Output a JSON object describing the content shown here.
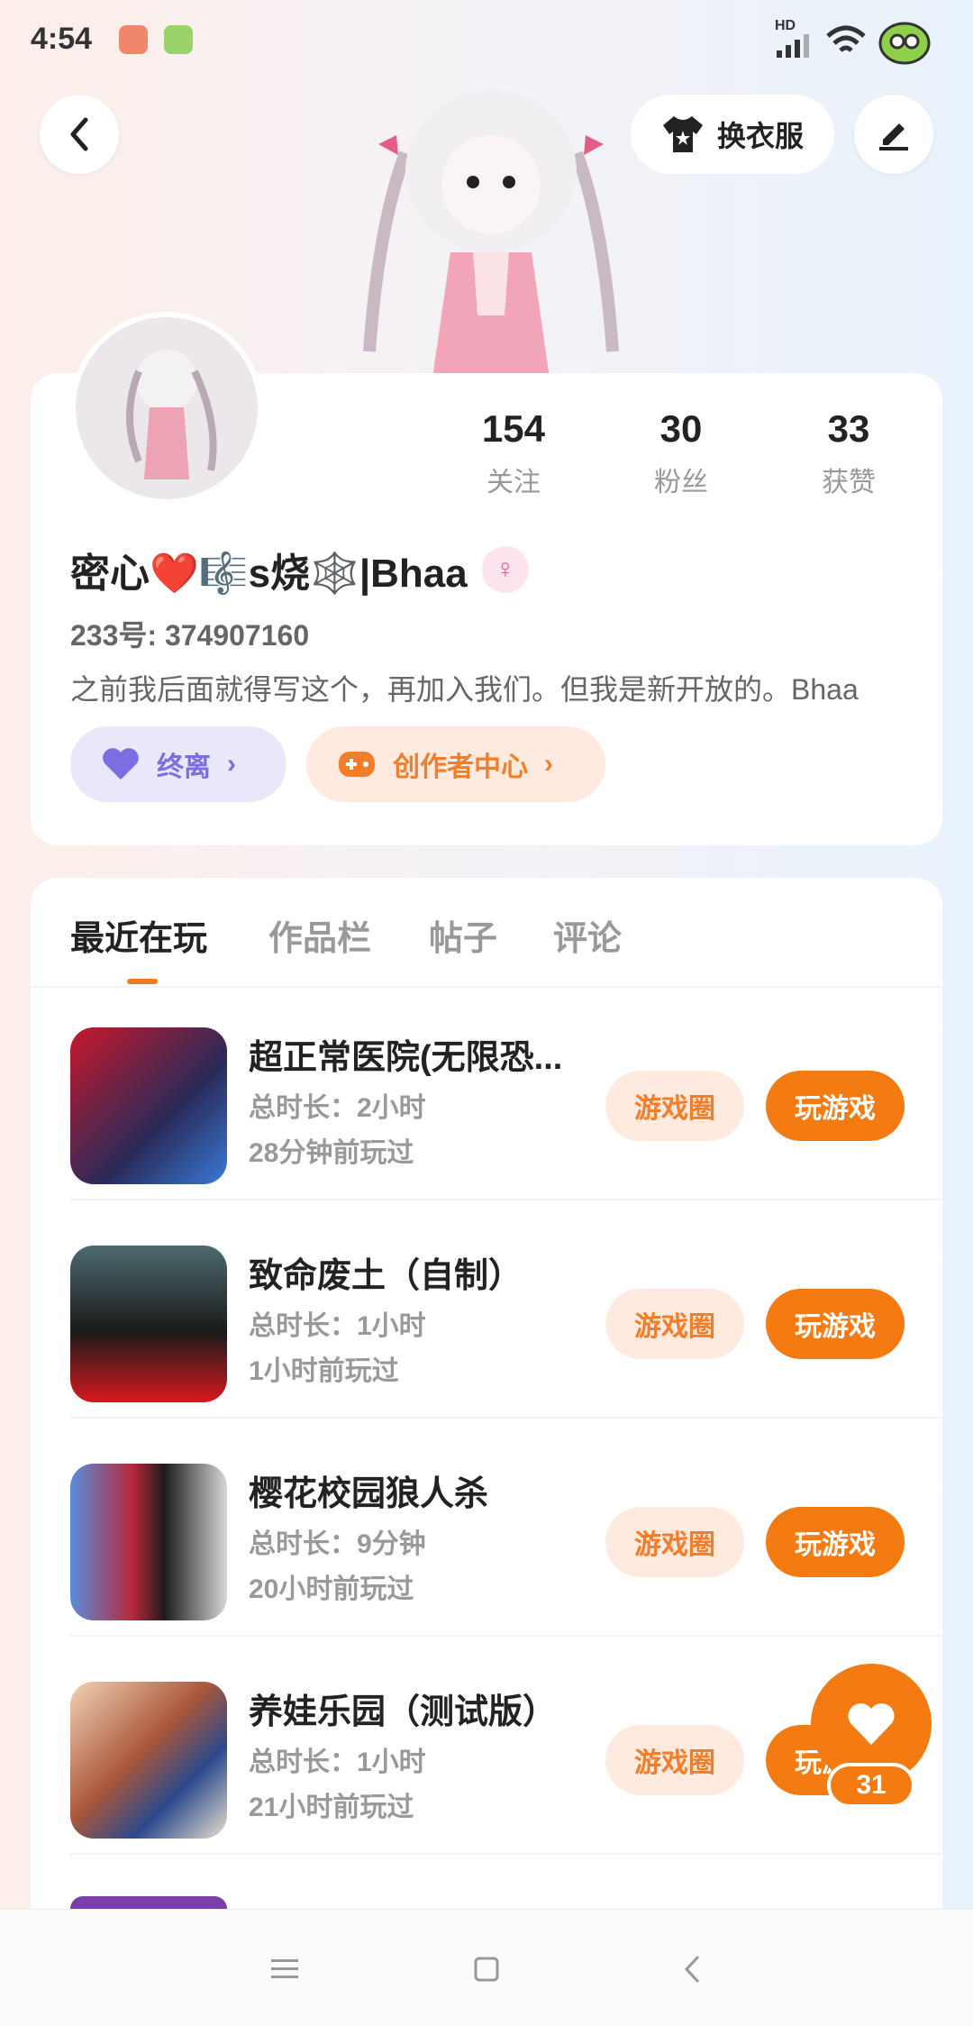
{
  "status": {
    "time": "4:54",
    "network": "HD"
  },
  "header": {
    "outfit_label": "换衣服"
  },
  "profile": {
    "stats": [
      {
        "num": "154",
        "label": "关注"
      },
      {
        "num": "30",
        "label": "粉丝"
      },
      {
        "num": "33",
        "label": "获赞"
      }
    ],
    "username": "密心❤️🎼s烧🕸️|Bhaa",
    "uid": "233号: 374907160",
    "bio": "之前我后面就得写这个，再加入我们。但我是新开放的。Bhaa",
    "tag_purple": "终离",
    "tag_orange": "创作者中心"
  },
  "tabs": [
    "最近在玩",
    "作品栏",
    "帖子",
    "评论"
  ],
  "games": [
    {
      "title": "超正常医院(无限恐...",
      "duration": "总时长：2小时",
      "last": "28分钟前玩过"
    },
    {
      "title": "致命废土（自制）",
      "duration": "总时长：1小时",
      "last": "1小时前玩过"
    },
    {
      "title": "樱花校园狼人杀",
      "duration": "总时长：9分钟",
      "last": "20小时前玩过"
    },
    {
      "title": "养娃乐园（测试版）",
      "duration": "总时长：1小时",
      "last": "21小时前玩过"
    }
  ],
  "game_buttons": {
    "circle": "游戏圈",
    "play": "玩游戏"
  },
  "like": {
    "count": "31"
  },
  "colors": {
    "accent": "#f47a12",
    "accent_light": "#ffeadf",
    "purple": "#7b6ee0"
  }
}
